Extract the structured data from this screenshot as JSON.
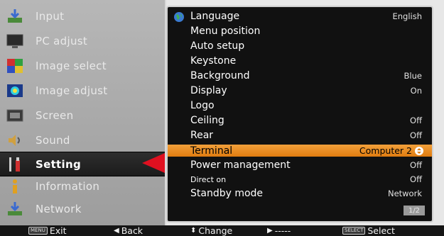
{
  "left_menu": [
    {
      "label": "Input",
      "icon": "input-icon",
      "active": false
    },
    {
      "label": "PC adjust",
      "icon": "pc-adjust-icon",
      "active": false
    },
    {
      "label": "Image select",
      "icon": "image-select-icon",
      "active": false
    },
    {
      "label": "Image adjust",
      "icon": "image-adjust-icon",
      "active": false
    },
    {
      "label": "Screen",
      "icon": "screen-icon",
      "active": false
    },
    {
      "label": "Sound",
      "icon": "sound-icon",
      "active": false
    },
    {
      "label": "Setting",
      "icon": "setting-icon",
      "active": true
    },
    {
      "label": "Information",
      "icon": "information-icon",
      "active": false
    },
    {
      "label": "Network",
      "icon": "network-icon",
      "active": false
    }
  ],
  "settings": [
    {
      "label": "Language",
      "value": "English"
    },
    {
      "label": "Menu position",
      "value": ""
    },
    {
      "label": "Auto setup",
      "value": ""
    },
    {
      "label": "Keystone",
      "value": ""
    },
    {
      "label": "Background",
      "value": "Blue"
    },
    {
      "label": "Display",
      "value": "On"
    },
    {
      "label": "Logo",
      "value": ""
    },
    {
      "label": "Ceiling",
      "value": "Off"
    },
    {
      "label": "Rear",
      "value": "Off"
    },
    {
      "label": "Terminal",
      "value": "Computer 2",
      "selected": true
    },
    {
      "label": "Power management",
      "value": "Off"
    },
    {
      "label": "Direct on",
      "value": "Off"
    },
    {
      "label": "Standby mode",
      "value": "Network"
    }
  ],
  "page_indicator": "1/2",
  "bottom_bar": {
    "exit_key": "MENU",
    "exit_label": "Exit",
    "back_label": "Back",
    "change_label": "Change",
    "next_label": "-----",
    "select_key": "SELECT",
    "select_label": "Select"
  },
  "colors": {
    "highlight": "#e88a1e",
    "pointer": "#e01020",
    "panel_bg": "#111111"
  }
}
